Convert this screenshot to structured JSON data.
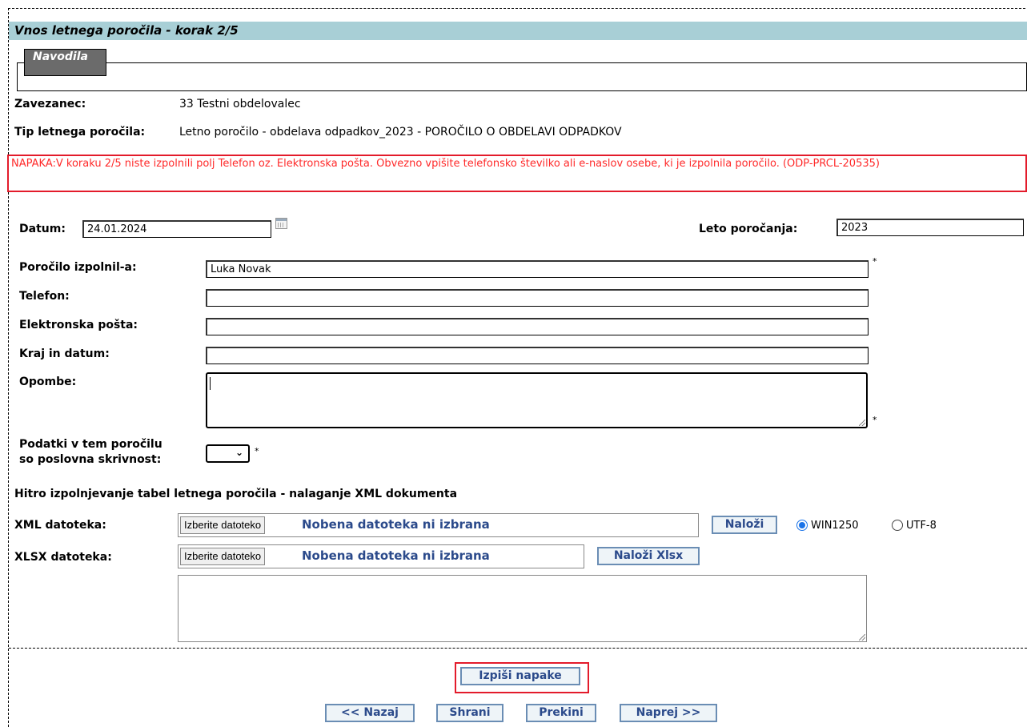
{
  "header": {
    "title": "Vnos letnega poročila - korak 2/5"
  },
  "guide": {
    "tab_label": "Navodila"
  },
  "info": {
    "zavezanec_label": "Zavezanec:",
    "zavezanec_value": "33 Testni obdelovalec",
    "tip_label": "Tip letnega poročila:",
    "tip_value": "Letno poročilo - obdelava odpadkov_2023 - POROČILO O OBDELAVI ODPADKOV"
  },
  "error": {
    "text": "NAPAKA:V koraku 2/5 niste izpolnili polj Telefon oz. Elektronska pošta. Obvezno vpišite telefonsko številko ali e-naslov osebe, ki je izpolnila poročilo. (ODP-PRCL-20535)",
    "color": "#ff2a2a"
  },
  "form": {
    "datum_label": "Datum:",
    "datum_value": "24.01.2024",
    "leto_label": "Leto poročanja:",
    "leto_value": "2023",
    "izpolnil_label": "Poročilo izpolnil-a:",
    "izpolnil_value": "Luka Novak",
    "telefon_label": "Telefon:",
    "telefon_value": "",
    "eposta_label": "Elektronska pošta:",
    "eposta_value": "",
    "kraj_label": "Kraj in datum:",
    "kraj_value": "",
    "opombe_label": "Opombe:",
    "skrivnost_label_1": "Podatki v tem poročilu",
    "skrivnost_label_2": "so poslovna skrivnost:",
    "skrivnost_value": "",
    "required_mark": "*"
  },
  "upload": {
    "heading": "Hitro izpolnjevanje tabel letnega poročila - nalaganje XML dokumenta",
    "xml_label": "XML datoteka:",
    "xlsx_label": "XLSX datoteka:",
    "choose_file": "Izberite datoteko",
    "no_file": "Nobena datoteka ni izbrana",
    "load_button": "Naloži",
    "load_xlsx_button": "Naloži Xlsx",
    "encoding_options": [
      "WIN1250",
      "UTF-8"
    ],
    "encoding_selected": "WIN1250"
  },
  "actions": {
    "izpisi_napake": "Izpiši napake",
    "nazaj": "<< Nazaj",
    "shrani": "Shrani",
    "prekini": "Prekini",
    "naprej": "Naprej >>"
  }
}
